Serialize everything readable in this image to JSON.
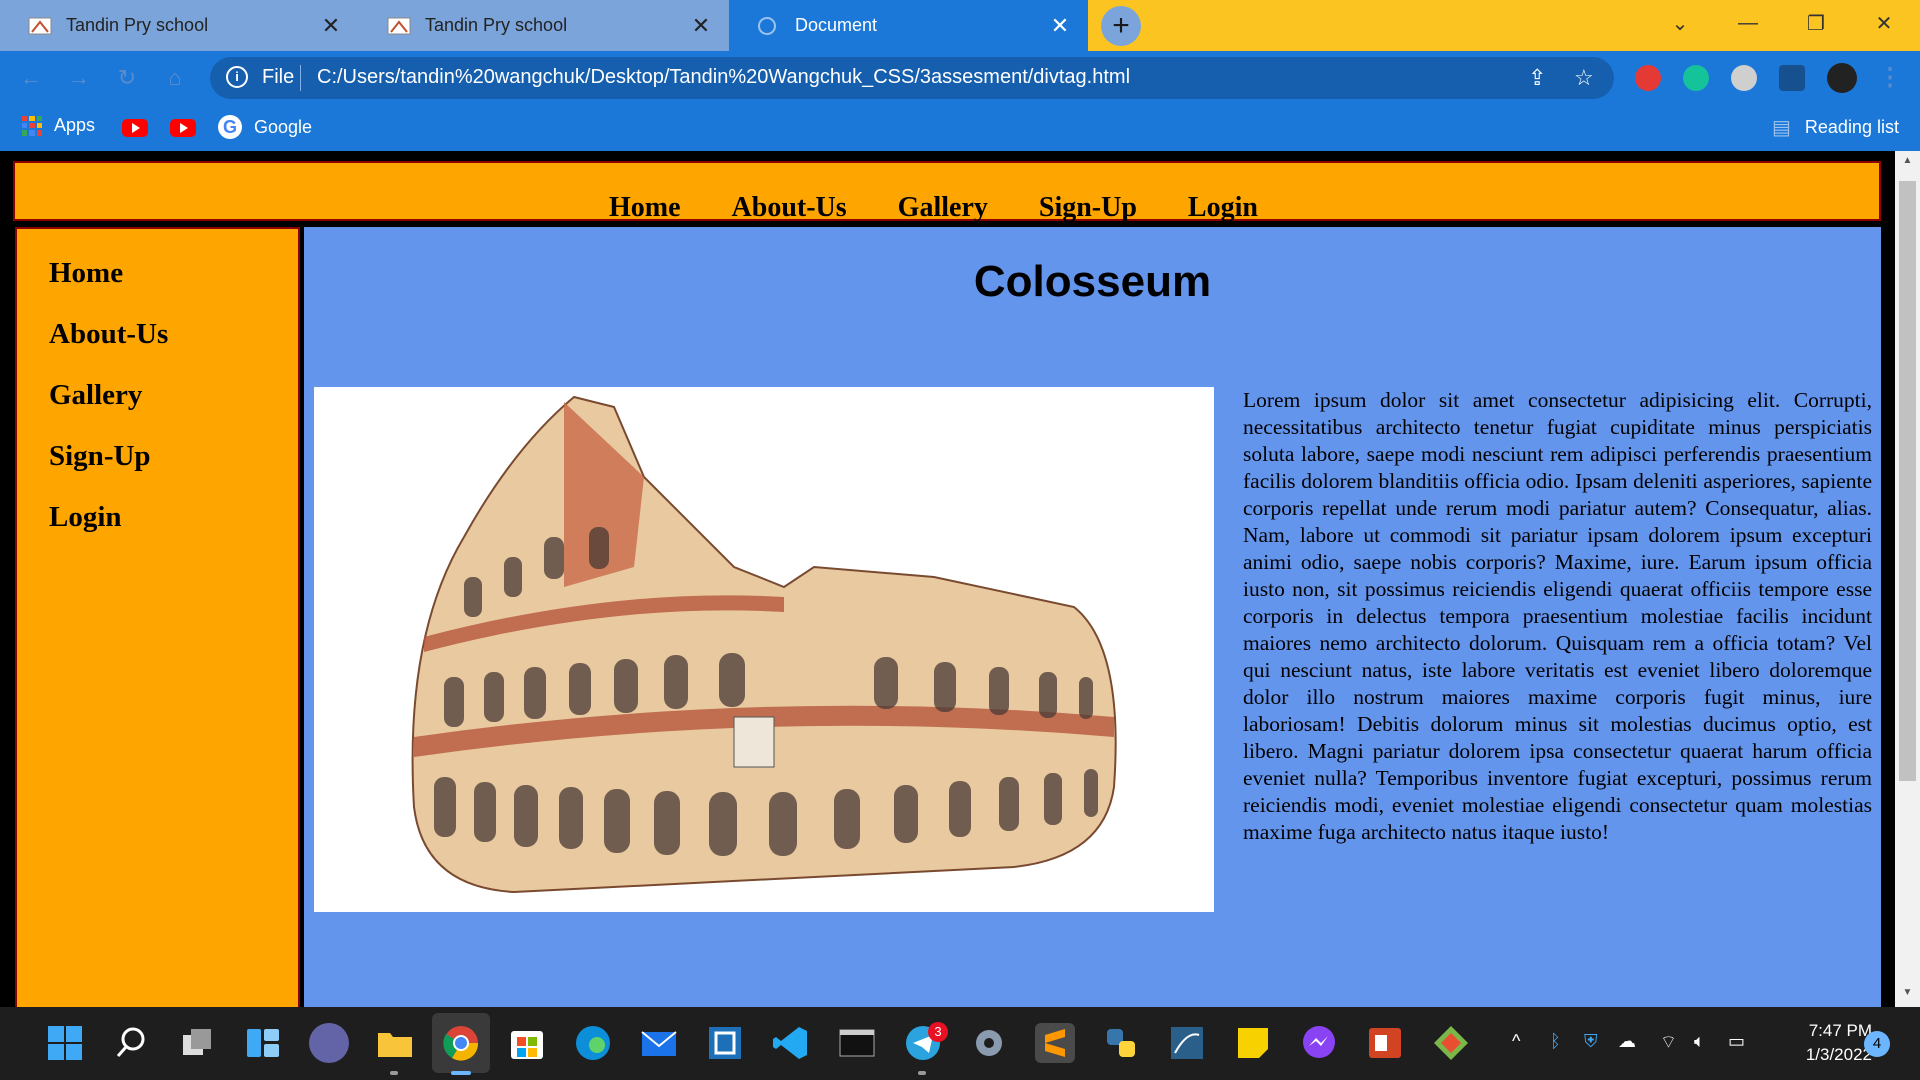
{
  "browser": {
    "tabs": [
      {
        "title": "Tandin Pry school",
        "active": false
      },
      {
        "title": "Tandin Pry school",
        "active": false
      },
      {
        "title": "Document",
        "active": true
      }
    ],
    "address": {
      "scheme": "File",
      "url": "C:/Users/tandin%20wangchuk/Desktop/Tandin%20Wangchuk_CSS/3assesment/divtag.html"
    },
    "bookmarks": {
      "apps": "Apps",
      "google": "Google",
      "reading_list": "Reading list"
    }
  },
  "page": {
    "top_nav": [
      "Home",
      "About-Us",
      "Gallery",
      "Sign-Up",
      "Login"
    ],
    "side_nav": [
      "Home",
      "About-Us",
      "Gallery",
      "Sign-Up",
      "Login"
    ],
    "heading": "Colosseum",
    "body_text": "Lorem ipsum dolor sit amet consectetur adipisicing elit. Corrupti, necessitatibus architecto tenetur fugiat cupiditate minus perspiciatis soluta labore, saepe modi nesciunt rem adipisci perferendis praesentium facilis dolorem blanditiis officia odio. Ipsam deleniti asperiores, sapiente corporis repellat unde rerum modi pariatur autem? Consequatur, alias. Nam, labore ut commodi sit pariatur ipsam dolorem ipsum excepturi animi odio, saepe nobis corporis? Maxime, iure. Earum ipsum officia iusto non, sit possimus reiciendis eligendi quaerat officiis tempore esse corporis in delectus tempora praesentium molestiae facilis incidunt maiores nemo architecto dolorum. Quisquam rem a officia totam? Vel qui nesciunt natus, iste labore veritatis est eveniet libero doloremque dolor illo nostrum maiores maxime corporis fugit minus, iure laboriosam! Debitis dolorum minus sit molestias ducimus optio, est libero. Magni pariatur dolorem ipsa consectetur quaerat harum officia eveniet nulla? Temporibus inventore fugiat excepturi, possimus rerum reiciendis modi, eveniet molestiae eligendi consectetur quam molestias maxime fuga architecto natus itaque iusto!",
    "colors": {
      "nav_bg": "#ffa500",
      "main_bg": "#6495ed",
      "border": "#8b0000"
    }
  },
  "taskbar": {
    "telegram_badge": "3",
    "time": "7:47 PM",
    "date": "1/3/2022",
    "notifications": "4"
  }
}
